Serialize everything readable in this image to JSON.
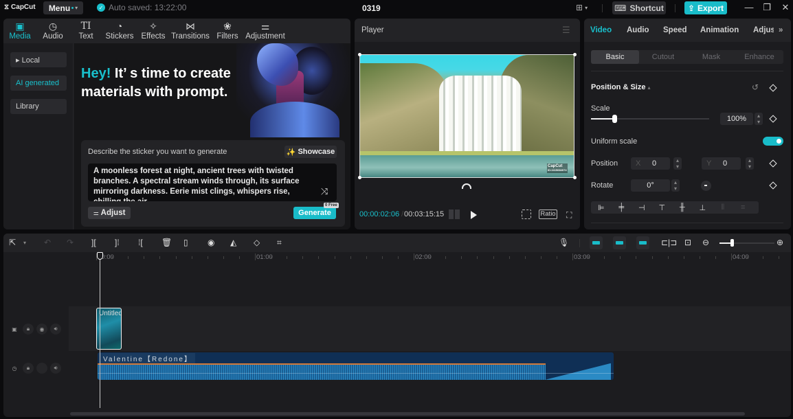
{
  "titlebar": {
    "app_name": "CapCut",
    "menu_label": "Menu",
    "autosave_text": "Auto saved: 13:22:00",
    "project_title": "0319",
    "layout_icon": "layout-icon",
    "shortcut_label": "Shortcut",
    "export_label": "Export",
    "window_controls": [
      "minimize",
      "restore",
      "close"
    ]
  },
  "media": {
    "tabs": [
      {
        "label": "Media",
        "icon": "▣",
        "active": true
      },
      {
        "label": "Audio",
        "icon": "◷"
      },
      {
        "label": "Text",
        "icon": "TI"
      },
      {
        "label": "Stickers",
        "icon": "◔"
      },
      {
        "label": "Effects",
        "icon": "✧"
      },
      {
        "label": "Transitions",
        "icon": "⋈"
      },
      {
        "label": "Filters",
        "icon": "❀"
      },
      {
        "label": "Adjustment",
        "icon": "⚌"
      }
    ],
    "sidebar": [
      {
        "label": "▸ Local"
      },
      {
        "label": "AI generated",
        "active": true
      },
      {
        "label": "Library"
      }
    ],
    "hero": {
      "accent": "Hey!",
      "text": " It’ s time to create materials with prompt."
    },
    "prompt": {
      "label": "Describe the sticker you want to generate",
      "showcase_label": "Showcase",
      "text": "A moonless forest at night, ancient trees with twisted branches. A spectral stream winds through, its surface mirroring darkness. Eerie mist clings, whispers rise, chilling the air.",
      "adjust_label": "Adjust",
      "generate_label": "Generate",
      "free_badge": "0 Free"
    }
  },
  "player": {
    "title": "Player",
    "watermark_line1": "CapCut",
    "watermark_line2": "ID:2415684074",
    "current_time": "00:00:02:06",
    "separator": "/",
    "total_time": "00:03:15:15",
    "ratio_label": "Ratio"
  },
  "properties": {
    "tabs": [
      "Video",
      "Audio",
      "Speed",
      "Animation",
      "Adjus"
    ],
    "active_tab": "Video",
    "more_icon": "»",
    "subtabs": [
      "Basic",
      "Cutout",
      "Mask",
      "Enhance"
    ],
    "section_title": "Position & Size",
    "scale_label": "Scale",
    "scale_value": "100%",
    "scale_slider_fraction": 0.2,
    "uniform_scale_label": "Uniform scale",
    "uniform_scale_on": true,
    "position_label": "Position",
    "x_label": "X",
    "x_value": "0",
    "y_label": "Y",
    "y_value": "0",
    "rotate_label": "Rotate",
    "rotate_value": "0°"
  },
  "timeline": {
    "ruler_labels": [
      "00:00",
      "01:00",
      "02:00",
      "03:00",
      "04:00"
    ],
    "video_clip_label": "Untitled",
    "audio_clip_label": "Valentine【Redone】",
    "zoom_fraction": 0.22
  }
}
